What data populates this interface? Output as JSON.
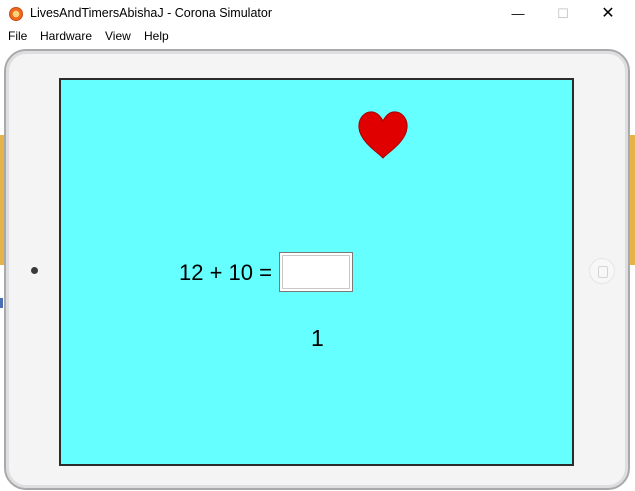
{
  "window": {
    "title": "LivesAndTimersAbishaJ - Corona Simulator",
    "app_icon": "corona-app-icon",
    "controls": {
      "minimize": "—",
      "maximize": "☐",
      "close": "✕"
    }
  },
  "menubar": {
    "items": [
      "File",
      "Hardware",
      "View",
      "Help"
    ]
  },
  "app": {
    "background_color": "#66ffff",
    "heart_color": "#e00000",
    "lives_icon": "heart-icon",
    "question": {
      "text": "12 + 10 =",
      "answer_value": "",
      "answer_placeholder": ""
    },
    "counter": "1"
  }
}
